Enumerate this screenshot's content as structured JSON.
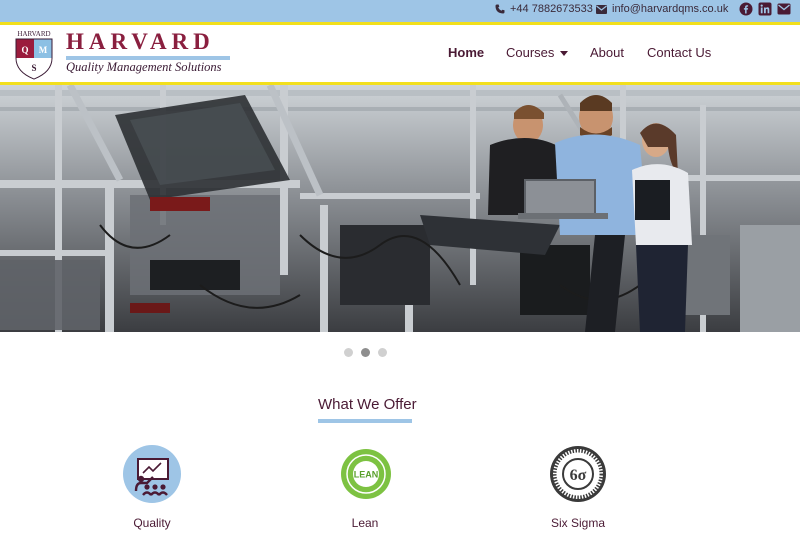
{
  "topbar": {
    "phone": "+44 7882673533",
    "email": "info@harvardqms.co.uk",
    "social_icons": [
      "facebook-icon",
      "linkedin-icon",
      "envelope-icon"
    ]
  },
  "brand": {
    "name": "HARVARD",
    "tagline": "Quality Management Solutions",
    "crest_text": "HARVARD",
    "crest_letters": [
      "Q",
      "M",
      "S"
    ]
  },
  "nav": {
    "items": [
      {
        "label": "Home"
      },
      {
        "label": "Courses"
      },
      {
        "label": "About"
      },
      {
        "label": "Contact Us"
      }
    ]
  },
  "carousel": {
    "slide_count": 3,
    "active_index": 1
  },
  "offer": {
    "title": "What We Offer",
    "cards": [
      {
        "label": "Quality",
        "icon": "presentation-icon"
      },
      {
        "label": "Lean",
        "icon": "lean-badge-icon",
        "badge_text": "LEAN"
      },
      {
        "label": "Six Sigma",
        "icon": "six-sigma-seal-icon",
        "badge_text": "6σ"
      }
    ]
  },
  "colors": {
    "topbar": "#9ec5e6",
    "accent_yellow": "#f2df1c",
    "brand_maroon": "#8a1f3f",
    "text": "#4a1a34"
  }
}
